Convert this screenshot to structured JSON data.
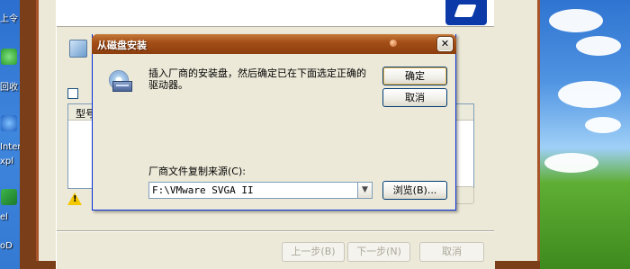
{
  "desktop": {
    "left_labels": [
      "上令",
      "回收",
      "Inter",
      "xpl",
      "el",
      "oD"
    ]
  },
  "wizard": {
    "list_header": "型号",
    "buttons": {
      "back": "上一步(B)",
      "next": "下一步(N)",
      "cancel": "取消"
    }
  },
  "dialog": {
    "title": "从磁盘安装",
    "message": "插入厂商的安装盘，然后确定已在下面选定正确的驱动器。",
    "ok_label": "确定",
    "cancel_label": "取消",
    "source_label": "厂商文件复制来源(C):",
    "source_value": "F:\\VMware SVGA II",
    "browse_label": "浏览(B)...",
    "close_glyph": "✕"
  },
  "colors": {
    "title_bar": "#a44f18",
    "dialog_bg": "#ece9d8",
    "button_border": "#003c74"
  }
}
